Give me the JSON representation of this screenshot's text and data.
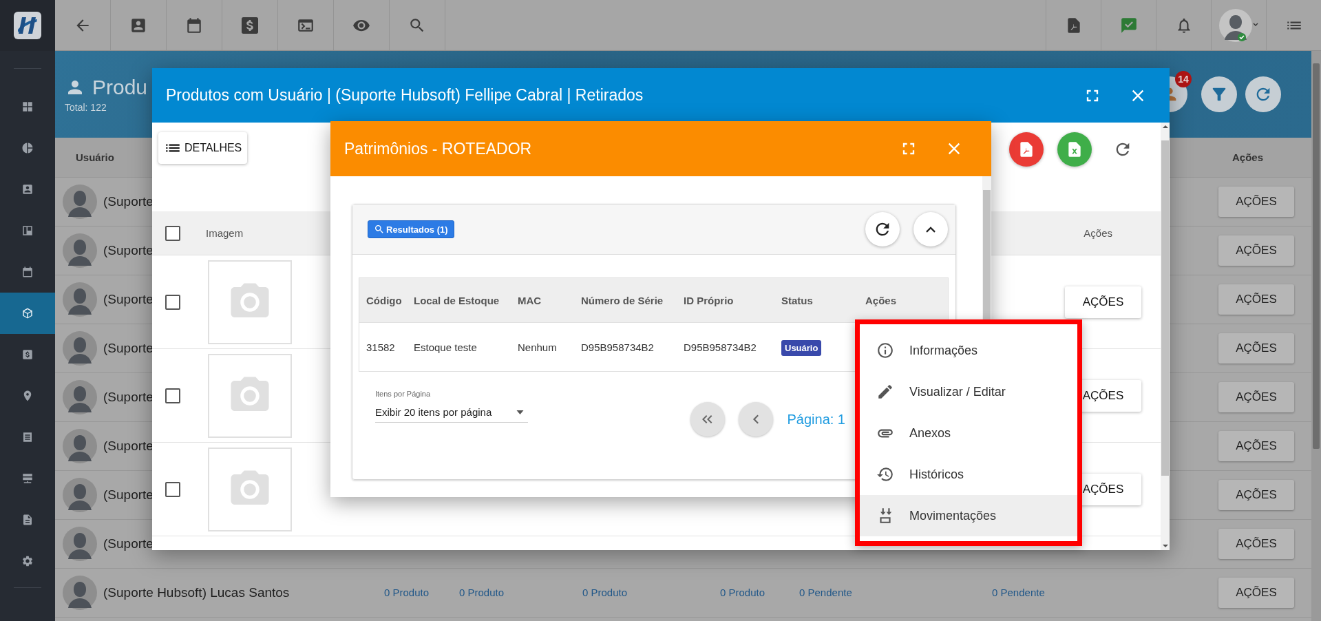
{
  "sidebar": {
    "items": [
      {
        "kind": "grid",
        "selected": false
      },
      {
        "kind": "pie",
        "selected": false
      },
      {
        "kind": "contact",
        "selected": false
      },
      {
        "kind": "board",
        "selected": false
      },
      {
        "kind": "calendar",
        "selected": false
      },
      {
        "kind": "box",
        "selected": true
      },
      {
        "kind": "money",
        "selected": false
      },
      {
        "kind": "pin",
        "selected": false
      },
      {
        "kind": "list",
        "selected": false
      },
      {
        "kind": "server",
        "selected": false
      },
      {
        "kind": "doc",
        "selected": false
      },
      {
        "kind": "gear",
        "selected": false
      }
    ]
  },
  "page": {
    "title": "Produ",
    "total": "Total: 122",
    "badge": "14",
    "columns": [
      "Usuário",
      "Ações"
    ],
    "rows": [
      {
        "user": "(Suporte",
        "action": "AÇÕES"
      },
      {
        "user": "(Suporte",
        "action": "AÇÕES"
      },
      {
        "user": "(Suporte",
        "action": "AÇÕES"
      },
      {
        "user": "(Suporte",
        "action": "AÇÕES"
      },
      {
        "user": "(Suporte",
        "action": "AÇÕES"
      },
      {
        "user": "(Suporte",
        "action": "AÇÕES"
      },
      {
        "user": "(Suporte",
        "action": "AÇÕES"
      },
      {
        "user": "(Suporte",
        "action": "AÇÕES"
      },
      {
        "user": "(Suporte Hubsoft) Lucas Santos",
        "cells": [
          "0 Produto",
          "0 Produto",
          "0 Produto",
          "0 Produto",
          "0 Pendente",
          "0 Pendente"
        ],
        "action": "AÇÕES"
      }
    ]
  },
  "dialog": {
    "title": "Produtos com Usuário | (Suporte Hubsoft) Fellipe Cabral | Retirados",
    "details_button": "DETALHES",
    "all_checked": false,
    "columns": [
      "Imagem",
      "Ações"
    ],
    "rows": [
      {
        "checked": false,
        "action": "AÇÕES"
      },
      {
        "checked": false,
        "action": "AÇÕES"
      },
      {
        "checked": false,
        "action": "AÇÕES"
      }
    ]
  },
  "subdialog": {
    "title": "Patrimônios - ROTEADOR",
    "chip": "Resultados (1)",
    "columns": [
      "Código",
      "Local de Estoque",
      "MAC",
      "Número de Série",
      "ID Próprio",
      "Status",
      "Ações"
    ],
    "rows": [
      {
        "cells": [
          "31582",
          "Estoque teste",
          "Nenhum",
          "D95B958734B2",
          "D95B958734B2"
        ],
        "status": "Usuário"
      }
    ],
    "page_size": {
      "label": "Itens por Página",
      "value": "Exibir 20 itens por página"
    },
    "page": "Página: 1"
  },
  "menu": {
    "items": [
      {
        "kind": "info",
        "label": "Informações",
        "highlighted": false
      },
      {
        "kind": "edit",
        "label": "Visualizar / Editar",
        "highlighted": false
      },
      {
        "kind": "attach",
        "label": "Anexos",
        "highlighted": false
      },
      {
        "kind": "history",
        "label": "Históricos",
        "highlighted": false
      },
      {
        "kind": "move",
        "label": "Movimentações",
        "highlighted": true
      }
    ]
  }
}
